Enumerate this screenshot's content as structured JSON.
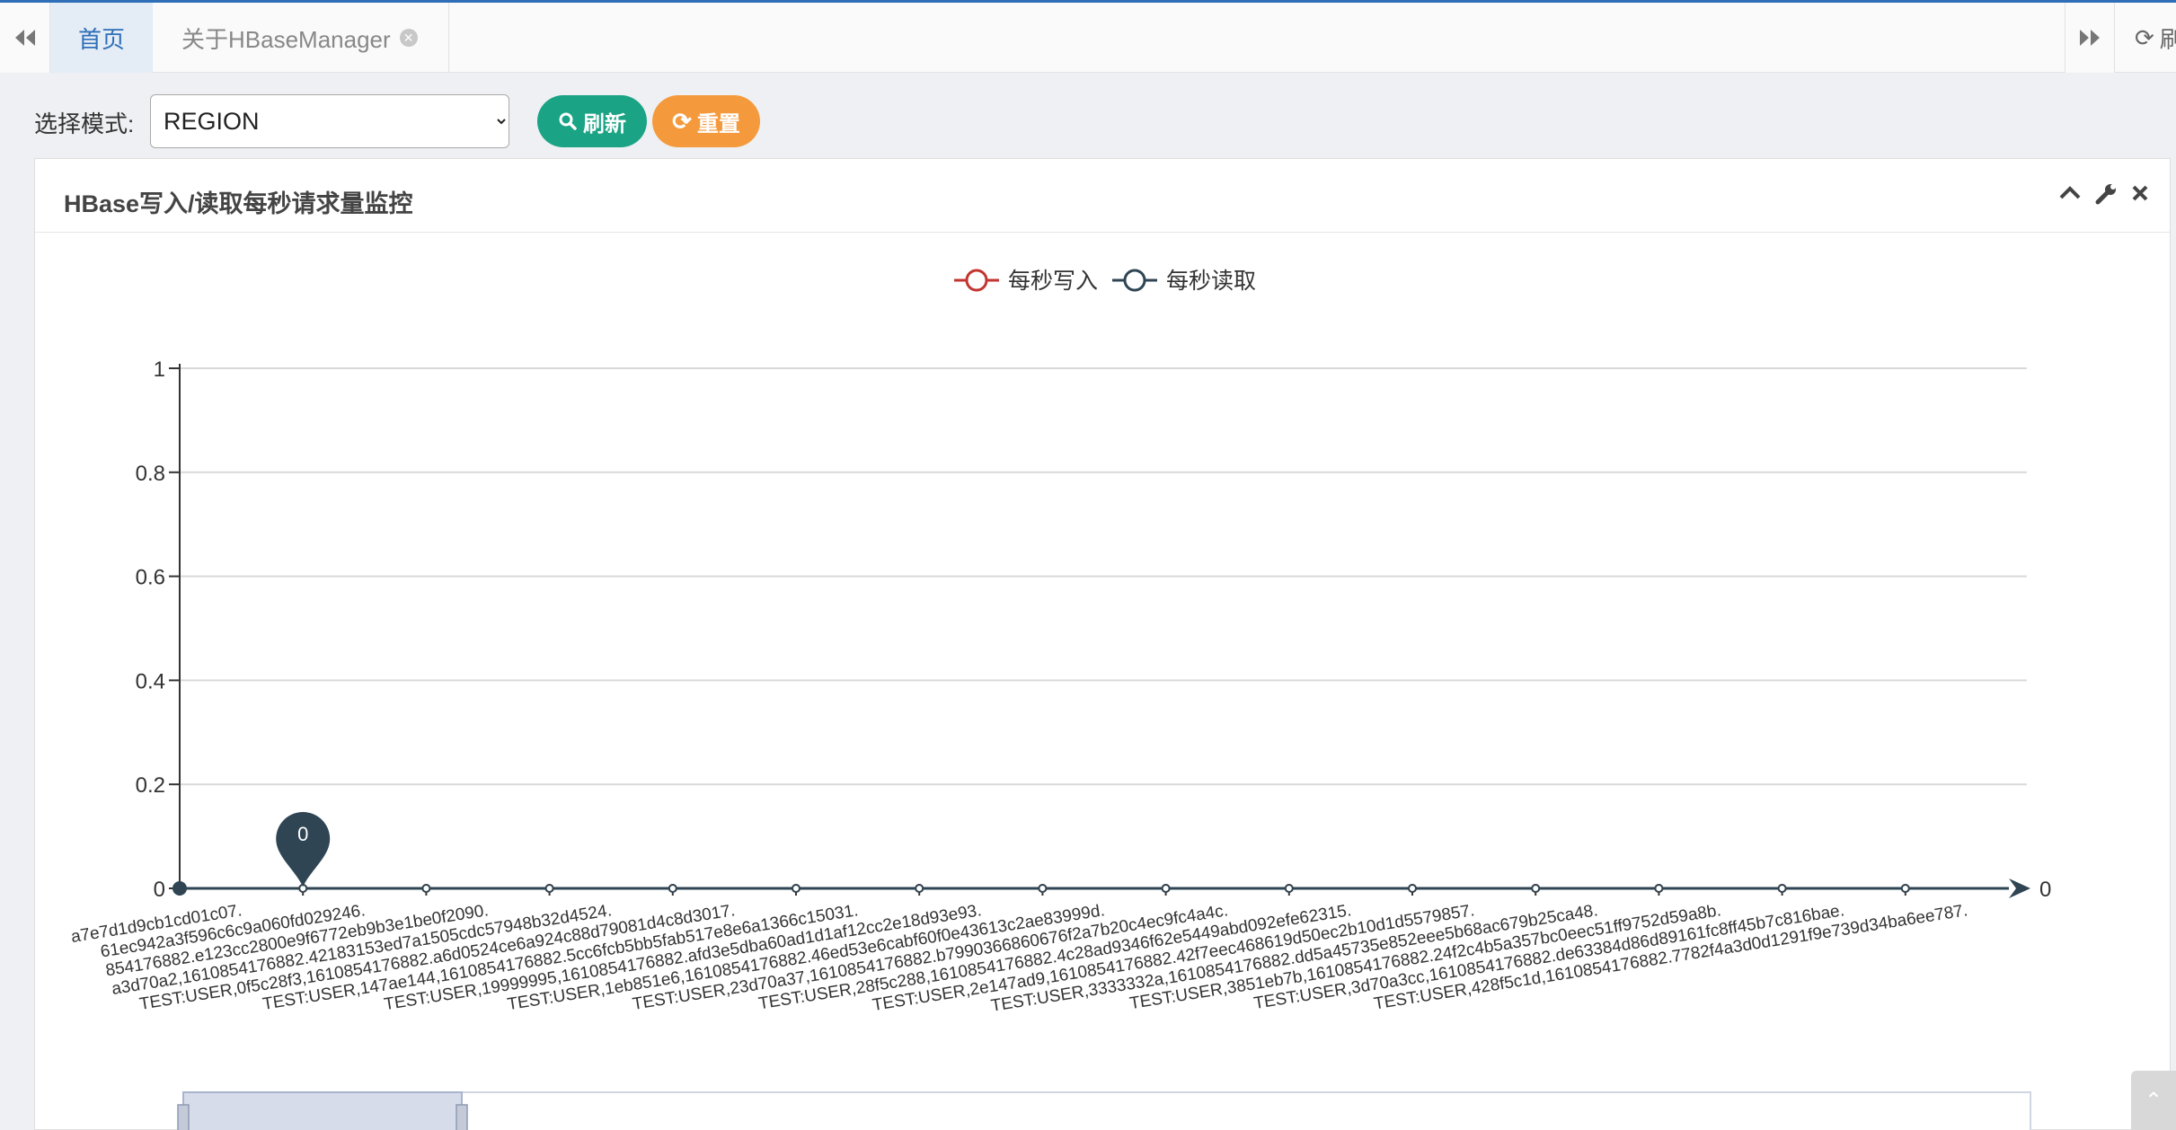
{
  "tabs": {
    "home_label": "首页",
    "about_label": "关于HBaseManager",
    "refresh_label": "刷新"
  },
  "toolbar": {
    "mode_label": "选择模式:",
    "mode_value": "REGION",
    "refresh_button": "刷新",
    "reset_button": "重置"
  },
  "panel": {
    "title": "HBase写入/读取每秒请求量监控"
  },
  "colors": {
    "write_series": "#c23531",
    "read_series": "#2f4554",
    "refresh_button": "#1aa384",
    "reset_button": "#f49a3c"
  },
  "chart_data": {
    "type": "line",
    "legend": [
      "每秒写入",
      "每秒读取"
    ],
    "yticks": [
      "1",
      "0.8",
      "0.6",
      "0.4",
      "0.2",
      "0"
    ],
    "ylim": [
      0,
      1
    ],
    "x_end_label": "0",
    "categories": [
      "a7e7d1d9cb1cd01c07.",
      "61ec942a3f596c6c9a060fd029246.",
      "854176882.e123cc2800e9f6772eb9b3e1be0f2090.",
      "a3d70a2,1610854176882.42183153ed7a1505cdc57948b32d4524.",
      "TEST:USER,0f5c28f3,1610854176882.a6d0524ce6a924c88d79081d4c8d3017.",
      "TEST:USER,147ae144,1610854176882.5cc6fcb5bb5fab517e8e6a1366c15031.",
      "TEST:USER,19999995,1610854176882.afd3e5dba60ad1d1af12cc2e18d93e93.",
      "TEST:USER,1eb851e6,1610854176882.46ed53e6cabf60f0e43613c2ae83999d.",
      "TEST:USER,23d70a37,1610854176882.b7990366860676f2a7b20c4ec9fc4a4c.",
      "TEST:USER,28f5c288,1610854176882.4c28ad9346f62e5449abd092efe62315.",
      "TEST:USER,2e147ad9,1610854176882.42f7eec468619d50ec2b10d1d5579857.",
      "TEST:USER,3333332a,1610854176882.dd5a45735e852eee5b68ac679b25ca48.",
      "TEST:USER,3851eb7b,1610854176882.24f2c4b5a357bc0eec51ff9752d59a8b.",
      "TEST:USER,3d70a3cc,1610854176882.de63384d86d89161fc8ff45b7c816bae.",
      "TEST:USER,428f5c1d,1610854176882.7782f4a3d0d1291f9e739d34ba6ee787."
    ],
    "series": [
      {
        "name": "每秒写入",
        "values": [
          0,
          0,
          0,
          0,
          0,
          0,
          0,
          0,
          0,
          0,
          0,
          0,
          0,
          0,
          0
        ]
      },
      {
        "name": "每秒读取",
        "values": [
          0,
          0,
          0,
          0,
          0,
          0,
          0,
          0,
          0,
          0,
          0,
          0,
          0,
          0,
          0
        ]
      }
    ],
    "markpoint": {
      "label": "0",
      "index": 1
    },
    "grid": true,
    "legend_position": "top-center"
  }
}
